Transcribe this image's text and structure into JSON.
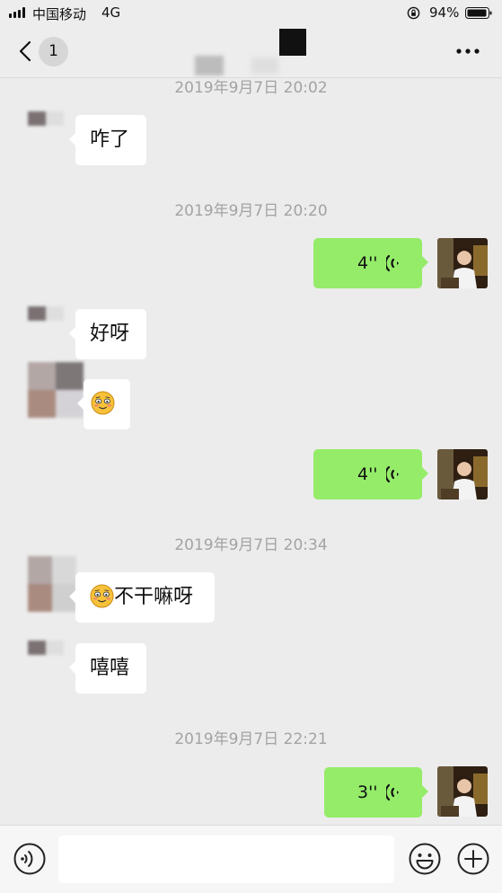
{
  "status_bar": {
    "carrier": "中国移动",
    "network": "4G",
    "battery": "94%"
  },
  "header": {
    "unread_count": "1"
  },
  "messages": {
    "t1": "2019年9月7日 20:02",
    "m1": "咋了",
    "t2": "2019年9月7日 20:20",
    "v1": "4''",
    "m2": "好呀",
    "v2": "4''",
    "t3": "2019年9月7日 20:34",
    "m4": "不干嘛呀",
    "m5": "嘻嘻",
    "t4": "2019年9月7日 22:21",
    "v3": "3''"
  },
  "input": {
    "placeholder": ""
  },
  "colors": {
    "outgoing_bubble": "#95ec69",
    "incoming_bubble": "#ffffff",
    "background": "#ececec"
  },
  "icons": [
    "back-icon",
    "more-icon",
    "voice-icon",
    "emoji-icon",
    "voice-toggle-icon",
    "plus-icon",
    "lock-rotation-icon",
    "battery-icon",
    "signal-icon"
  ]
}
